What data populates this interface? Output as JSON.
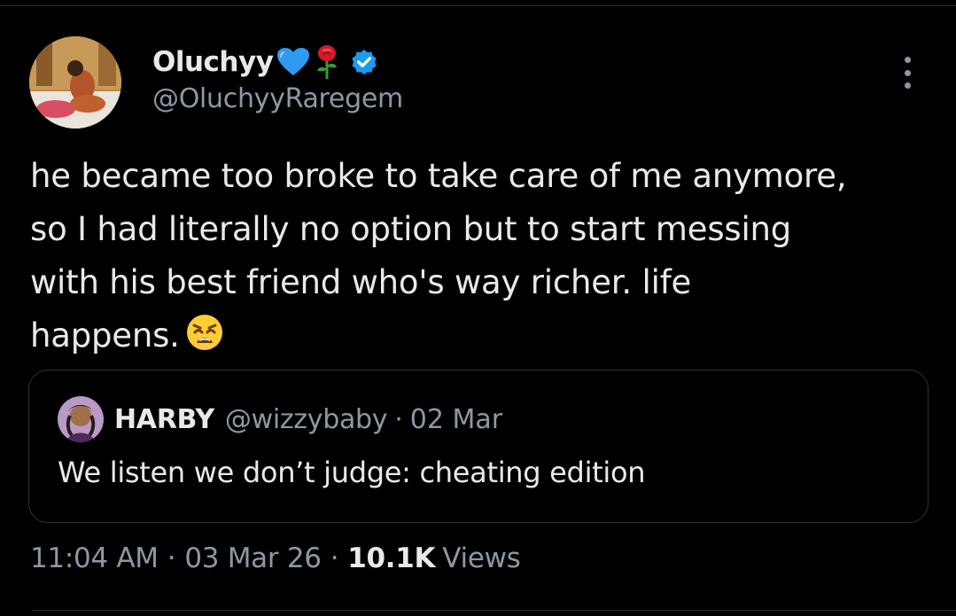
{
  "author": {
    "display_name": "Oluchyy",
    "handle": "@OluchyyRaregem",
    "verified": true,
    "name_emojis": [
      "blue-heart",
      "rose"
    ]
  },
  "tweet": {
    "text": "he became too broke to take care of me anymore,\nso I had literally no option but to start messing\nwith his best friend who's way richer. life\nhappens.",
    "trailing_emoji": "weary-face"
  },
  "quoted": {
    "display_name": "HARBY",
    "handle": "@wizzybaby",
    "separator": "·",
    "date": "02 Mar",
    "text": "We listen we don’t judge: cheating edition"
  },
  "meta": {
    "time": "11:04 AM",
    "separator": "·",
    "date": "03 Mar 26",
    "views_count": "10.1K",
    "views_label": "Views"
  },
  "colors": {
    "background": "#000000",
    "text": "#e7e9ea",
    "secondary": "#8b98a5",
    "verified_blue": "#1d9bf0",
    "border": "#2f3336"
  }
}
